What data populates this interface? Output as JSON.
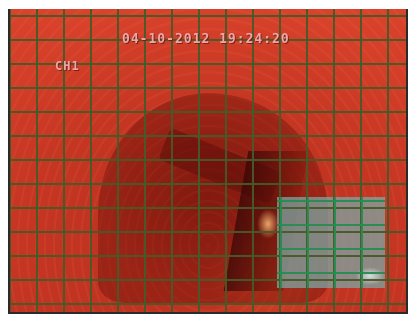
{
  "osd": {
    "timestamp": "04-10-2012 19:24:20",
    "channel": "CH1"
  },
  "motion_detection": {
    "grid_color": "#465a28",
    "active_zone_color": "#7aaaaa",
    "active_zone_grid_color": "#288c50"
  },
  "colors": {
    "video_tint": "#cc3a25"
  }
}
